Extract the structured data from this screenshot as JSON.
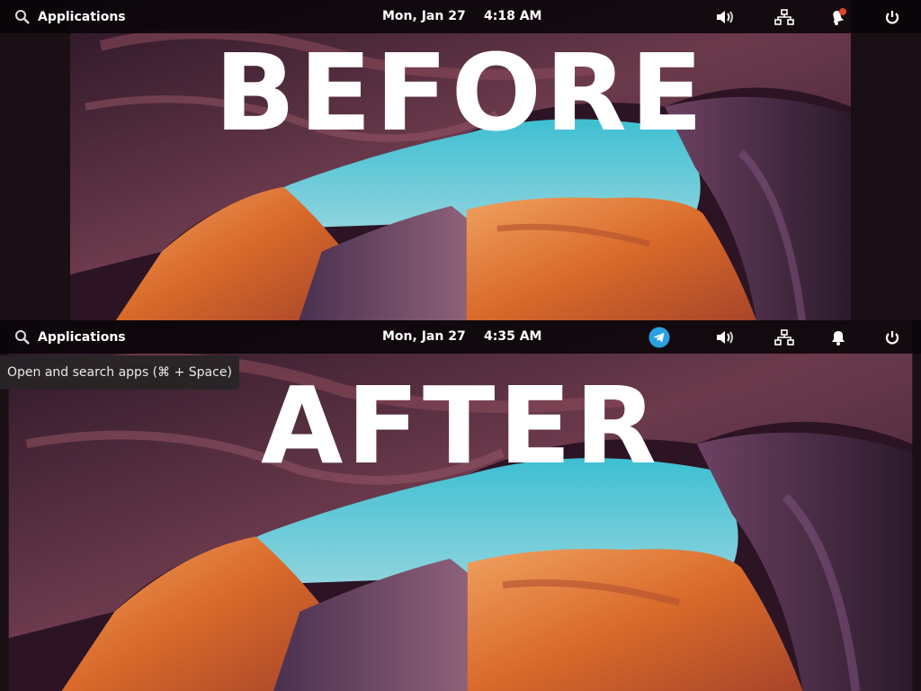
{
  "before": {
    "label": "BEFORE",
    "panel": {
      "applications_label": "Applications",
      "date": "Mon, Jan 27",
      "time": "4:18 AM",
      "indicators": [
        "volume-icon",
        "network-icon",
        "notification-bell-icon",
        "power-icon"
      ],
      "notification_badge": true
    }
  },
  "after": {
    "label": "AFTER",
    "panel": {
      "applications_label": "Applications",
      "date": "Mon, Jan 27",
      "time": "4:35 AM",
      "indicators": [
        "telegram-icon",
        "volume-icon",
        "network-icon",
        "notification-bell-icon",
        "power-icon"
      ],
      "notification_badge": false
    },
    "tooltip": "Open and search apps (⌘ + Space)"
  },
  "colors": {
    "sky": "#5ec3d3",
    "panel_bg": "#080408",
    "telegram": "#2aa0e0",
    "badge": "#e0442c"
  }
}
